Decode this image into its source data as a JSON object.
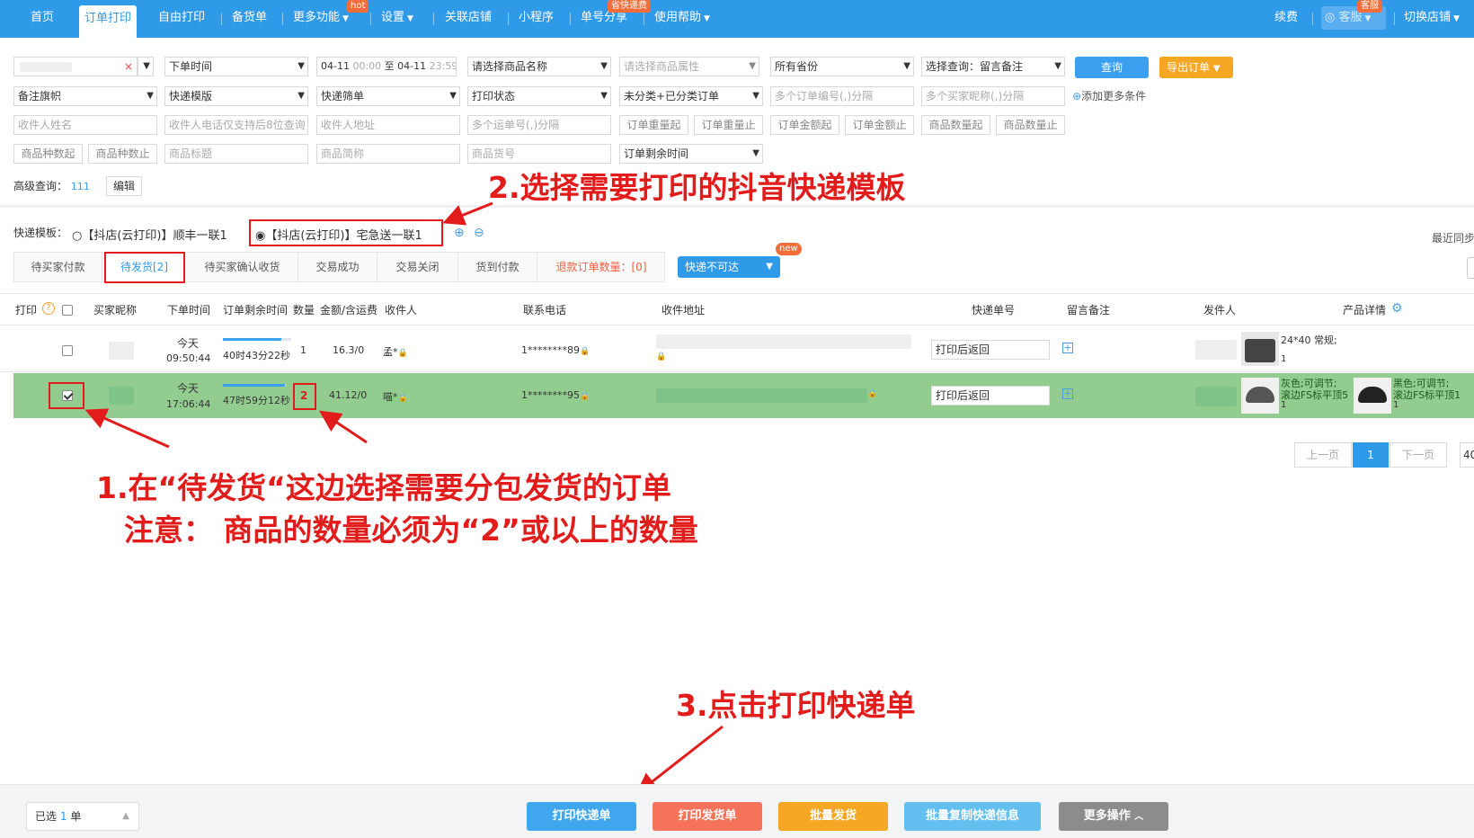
{
  "nav": {
    "items": [
      "首页",
      "订单打印",
      "自由打印",
      "备货单",
      "更多功能",
      "设置",
      "关联店铺",
      "小程序",
      "单号分享",
      "使用帮助"
    ],
    "hot_tag": "hot",
    "save_tag": "省快递费",
    "right": {
      "renew": "续费",
      "service": "客服",
      "service_tag": "客服",
      "switch_shop": "切换店铺"
    }
  },
  "filters": {
    "row1": {
      "clear": "×",
      "order_time": "下单时间",
      "date_start": "04-11",
      "date_start_time": "00:00",
      "date_to": "至",
      "date_end": "04-11",
      "date_end_time": "23:59",
      "product_name": "请选择商品名称",
      "product_attr": "请选择商品属性",
      "province": "所有省份",
      "select_query": "选择查询：留言备注"
    },
    "row2": {
      "remark_flag": "备注旗帜",
      "express_tpl": "快递模版",
      "express_filter": "快递筛单",
      "print_status": "打印状态",
      "category": "未分类+已分类订单",
      "order_nos_ph": "多个订单编号(,)分隔",
      "buyer_nicks_ph": "多个买家昵称(,)分隔",
      "add_more": "添加更多条件"
    },
    "row3": {
      "receiver_name": "收件人姓名",
      "receiver_phone": "收件人电话仅支持后8位查询",
      "receiver_addr": "收件人地址",
      "waybill_nos": "多个运单号(,)分隔",
      "weight_from": "订单重量起",
      "weight_to": "订单重量止",
      "amount_from": "订单金额起",
      "amount_to": "订单金额止",
      "qty_from": "商品数量起",
      "qty_to": "商品数量止"
    },
    "row4": {
      "kinds_from": "商品种数起",
      "kinds_to": "商品种数止",
      "title": "商品标题",
      "short_name": "商品简称",
      "sku_no": "商品货号",
      "remain_time": "订单剩余时间"
    },
    "query_button": "查询",
    "export_button": "导出订单",
    "advanced_label": "高级查询：",
    "advanced_value": "111",
    "edit_button": "编辑"
  },
  "templates": {
    "label": "快递模板：",
    "options": [
      "【抖店(云打印)】顺丰一联1",
      "【抖店(云打印)】宅急送一联1"
    ],
    "selected_index": 1,
    "recent_sync": "最近同步"
  },
  "tabs": {
    "items": [
      "待买家付款",
      "待发货[2]",
      "待买家确认收货",
      "交易成功",
      "交易关闭",
      "货到付款",
      "退款订单数量：[0]"
    ],
    "active_index": 1,
    "express_unreachable": "快递不可达",
    "new_tag": "new"
  },
  "table": {
    "headers": [
      "打印",
      "买家昵称",
      "下单时间",
      "订单剩余时间",
      "数量",
      "金额/含运费",
      "收件人",
      "联系电话",
      "收件地址",
      "快递单号",
      "留言备注",
      "发件人",
      "产品详情"
    ],
    "rows": [
      {
        "checked": false,
        "date": "今天",
        "time": "09:50:44",
        "remaining": "40时43分22秒",
        "remaining_fraction": 0.85,
        "qty": "1",
        "amount": "16.3/0",
        "receiver": "孟*",
        "phone": "1********89",
        "waybill": "打印后返回",
        "product": {
          "text": "24*40 常规;",
          "qty": "1"
        }
      },
      {
        "checked": true,
        "date": "今天",
        "time": "17:06:44",
        "remaining": "47时59分12秒",
        "remaining_fraction": 0.99,
        "qty": "2",
        "amount": "41.12/0",
        "receiver": "喵*",
        "phone": "1********95",
        "waybill": "打印后返回",
        "products": [
          {
            "text1": "灰色;可调节;",
            "text2": "滚边FS标平顶5",
            "qty": "1"
          },
          {
            "text1": "黑色;可调节;",
            "text2": "滚边FS标平顶1",
            "qty": "1"
          }
        ]
      }
    ]
  },
  "pagination": {
    "prev": "上一页",
    "current": "1",
    "next": "下一页",
    "size": "40"
  },
  "annotations": {
    "step1_line1": "1.在“待发货“这边选择需要分包发货的订单",
    "step1_line2": "注意：  商品的数量必须为“2”或以上的数量",
    "step2": "2.选择需要打印的抖音快递模板",
    "step3": "3.点击打印快递单"
  },
  "bottom": {
    "selected_prefix": "已选",
    "selected_count": "1",
    "selected_suffix": "单",
    "buttons": [
      "打印快递单",
      "打印发货单",
      "批量发货",
      "批量复制快递信息",
      "更多操作"
    ]
  },
  "colors": {
    "nav": "#2f9ae8",
    "selected_row": "#92cd8f",
    "annotation": "#e21b1b",
    "print_btn": "#40a6ee",
    "ship_btn": "#f4735a",
    "batch_btn": "#f5a623",
    "copy_btn": "#63bff0",
    "more_btn": "#8c8c8c"
  }
}
